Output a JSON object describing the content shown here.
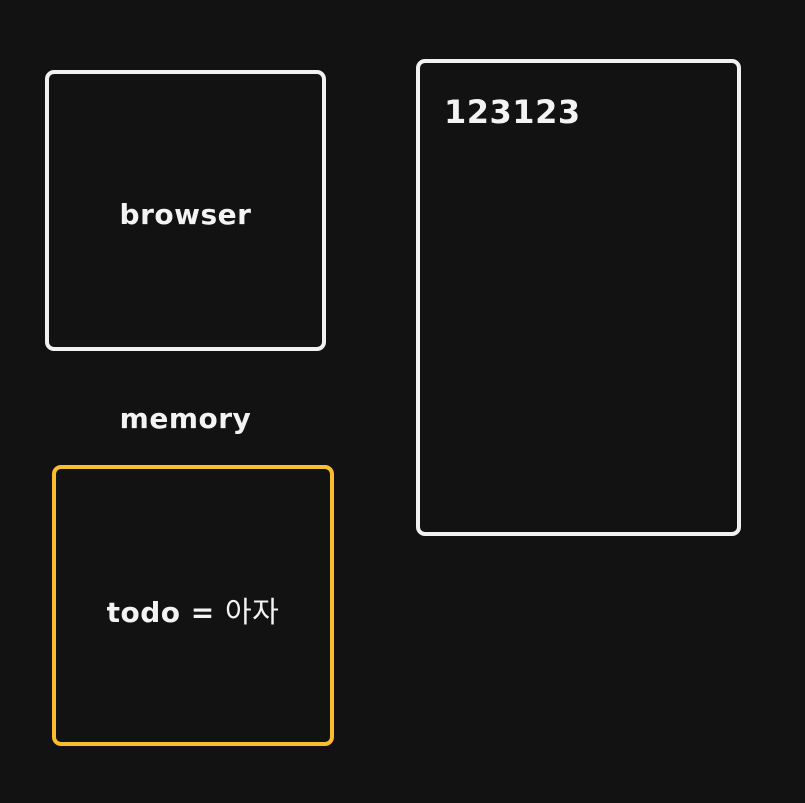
{
  "diagram": {
    "browser": {
      "label": "browser"
    },
    "output": {
      "text": "123123"
    },
    "memory": {
      "label": "memory",
      "todo_key": "todo",
      "todo_op": "=",
      "todo_value": "아자"
    }
  },
  "colors": {
    "background": "#121212",
    "box_stroke": "#f1f1f1",
    "memory_stroke": "#fbbd2e",
    "text": "#f3f3f3"
  }
}
